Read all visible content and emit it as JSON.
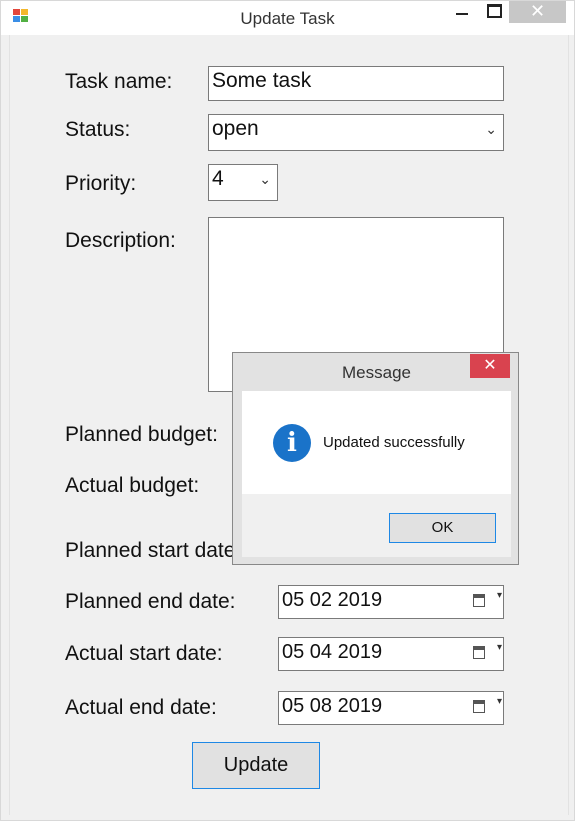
{
  "window": {
    "title": "Update Task",
    "close_glyph": "✕"
  },
  "form": {
    "task_name_label": "Task name:",
    "task_name_value": "Some task",
    "status_label": "Status:",
    "status_value": "open",
    "priority_label": "Priority:",
    "priority_value": "4",
    "description_label": "Description:",
    "description_value": "",
    "planned_budget_label": "Planned budget:",
    "actual_budget_label": "Actual budget:",
    "planned_start_label": "Planned start date:",
    "planned_end_label": "Planned end date:",
    "planned_end_value": "05 02 2019",
    "actual_start_label": "Actual start date:",
    "actual_start_value": "05 04 2019",
    "actual_end_label": "Actual end date:",
    "actual_end_value": "05 08 2019",
    "update_button": "Update",
    "chevron_glyph": "⌄"
  },
  "dialog": {
    "title": "Message",
    "close_glyph": "✕",
    "icon_glyph": "i",
    "message": "Updated successfully",
    "ok_button": "OK"
  },
  "colors": {
    "accent_border": "#1e88e5",
    "close_red": "#d9434f",
    "info_blue": "#1a73c9"
  },
  "icons": [
    "app-icon",
    "minimize-icon",
    "maximize-icon",
    "close-icon",
    "chevron-down-icon",
    "calendar-icon",
    "info-icon"
  ]
}
